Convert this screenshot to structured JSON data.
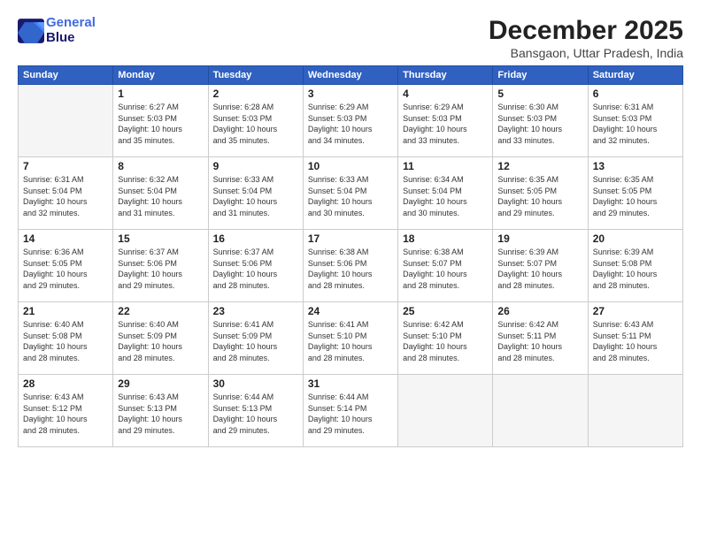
{
  "header": {
    "logo_line1": "General",
    "logo_line2": "Blue",
    "month": "December 2025",
    "location": "Bansgaon, Uttar Pradesh, India"
  },
  "weekdays": [
    "Sunday",
    "Monday",
    "Tuesday",
    "Wednesday",
    "Thursday",
    "Friday",
    "Saturday"
  ],
  "weeks": [
    [
      {
        "day": "",
        "text": ""
      },
      {
        "day": "1",
        "text": "Sunrise: 6:27 AM\nSunset: 5:03 PM\nDaylight: 10 hours\nand 35 minutes."
      },
      {
        "day": "2",
        "text": "Sunrise: 6:28 AM\nSunset: 5:03 PM\nDaylight: 10 hours\nand 35 minutes."
      },
      {
        "day": "3",
        "text": "Sunrise: 6:29 AM\nSunset: 5:03 PM\nDaylight: 10 hours\nand 34 minutes."
      },
      {
        "day": "4",
        "text": "Sunrise: 6:29 AM\nSunset: 5:03 PM\nDaylight: 10 hours\nand 33 minutes."
      },
      {
        "day": "5",
        "text": "Sunrise: 6:30 AM\nSunset: 5:03 PM\nDaylight: 10 hours\nand 33 minutes."
      },
      {
        "day": "6",
        "text": "Sunrise: 6:31 AM\nSunset: 5:03 PM\nDaylight: 10 hours\nand 32 minutes."
      }
    ],
    [
      {
        "day": "7",
        "text": "Sunrise: 6:31 AM\nSunset: 5:04 PM\nDaylight: 10 hours\nand 32 minutes."
      },
      {
        "day": "8",
        "text": "Sunrise: 6:32 AM\nSunset: 5:04 PM\nDaylight: 10 hours\nand 31 minutes."
      },
      {
        "day": "9",
        "text": "Sunrise: 6:33 AM\nSunset: 5:04 PM\nDaylight: 10 hours\nand 31 minutes."
      },
      {
        "day": "10",
        "text": "Sunrise: 6:33 AM\nSunset: 5:04 PM\nDaylight: 10 hours\nand 30 minutes."
      },
      {
        "day": "11",
        "text": "Sunrise: 6:34 AM\nSunset: 5:04 PM\nDaylight: 10 hours\nand 30 minutes."
      },
      {
        "day": "12",
        "text": "Sunrise: 6:35 AM\nSunset: 5:05 PM\nDaylight: 10 hours\nand 29 minutes."
      },
      {
        "day": "13",
        "text": "Sunrise: 6:35 AM\nSunset: 5:05 PM\nDaylight: 10 hours\nand 29 minutes."
      }
    ],
    [
      {
        "day": "14",
        "text": "Sunrise: 6:36 AM\nSunset: 5:05 PM\nDaylight: 10 hours\nand 29 minutes."
      },
      {
        "day": "15",
        "text": "Sunrise: 6:37 AM\nSunset: 5:06 PM\nDaylight: 10 hours\nand 29 minutes."
      },
      {
        "day": "16",
        "text": "Sunrise: 6:37 AM\nSunset: 5:06 PM\nDaylight: 10 hours\nand 28 minutes."
      },
      {
        "day": "17",
        "text": "Sunrise: 6:38 AM\nSunset: 5:06 PM\nDaylight: 10 hours\nand 28 minutes."
      },
      {
        "day": "18",
        "text": "Sunrise: 6:38 AM\nSunset: 5:07 PM\nDaylight: 10 hours\nand 28 minutes."
      },
      {
        "day": "19",
        "text": "Sunrise: 6:39 AM\nSunset: 5:07 PM\nDaylight: 10 hours\nand 28 minutes."
      },
      {
        "day": "20",
        "text": "Sunrise: 6:39 AM\nSunset: 5:08 PM\nDaylight: 10 hours\nand 28 minutes."
      }
    ],
    [
      {
        "day": "21",
        "text": "Sunrise: 6:40 AM\nSunset: 5:08 PM\nDaylight: 10 hours\nand 28 minutes."
      },
      {
        "day": "22",
        "text": "Sunrise: 6:40 AM\nSunset: 5:09 PM\nDaylight: 10 hours\nand 28 minutes."
      },
      {
        "day": "23",
        "text": "Sunrise: 6:41 AM\nSunset: 5:09 PM\nDaylight: 10 hours\nand 28 minutes."
      },
      {
        "day": "24",
        "text": "Sunrise: 6:41 AM\nSunset: 5:10 PM\nDaylight: 10 hours\nand 28 minutes."
      },
      {
        "day": "25",
        "text": "Sunrise: 6:42 AM\nSunset: 5:10 PM\nDaylight: 10 hours\nand 28 minutes."
      },
      {
        "day": "26",
        "text": "Sunrise: 6:42 AM\nSunset: 5:11 PM\nDaylight: 10 hours\nand 28 minutes."
      },
      {
        "day": "27",
        "text": "Sunrise: 6:43 AM\nSunset: 5:11 PM\nDaylight: 10 hours\nand 28 minutes."
      }
    ],
    [
      {
        "day": "28",
        "text": "Sunrise: 6:43 AM\nSunset: 5:12 PM\nDaylight: 10 hours\nand 28 minutes."
      },
      {
        "day": "29",
        "text": "Sunrise: 6:43 AM\nSunset: 5:13 PM\nDaylight: 10 hours\nand 29 minutes."
      },
      {
        "day": "30",
        "text": "Sunrise: 6:44 AM\nSunset: 5:13 PM\nDaylight: 10 hours\nand 29 minutes."
      },
      {
        "day": "31",
        "text": "Sunrise: 6:44 AM\nSunset: 5:14 PM\nDaylight: 10 hours\nand 29 minutes."
      },
      {
        "day": "",
        "text": ""
      },
      {
        "day": "",
        "text": ""
      },
      {
        "day": "",
        "text": ""
      }
    ]
  ]
}
